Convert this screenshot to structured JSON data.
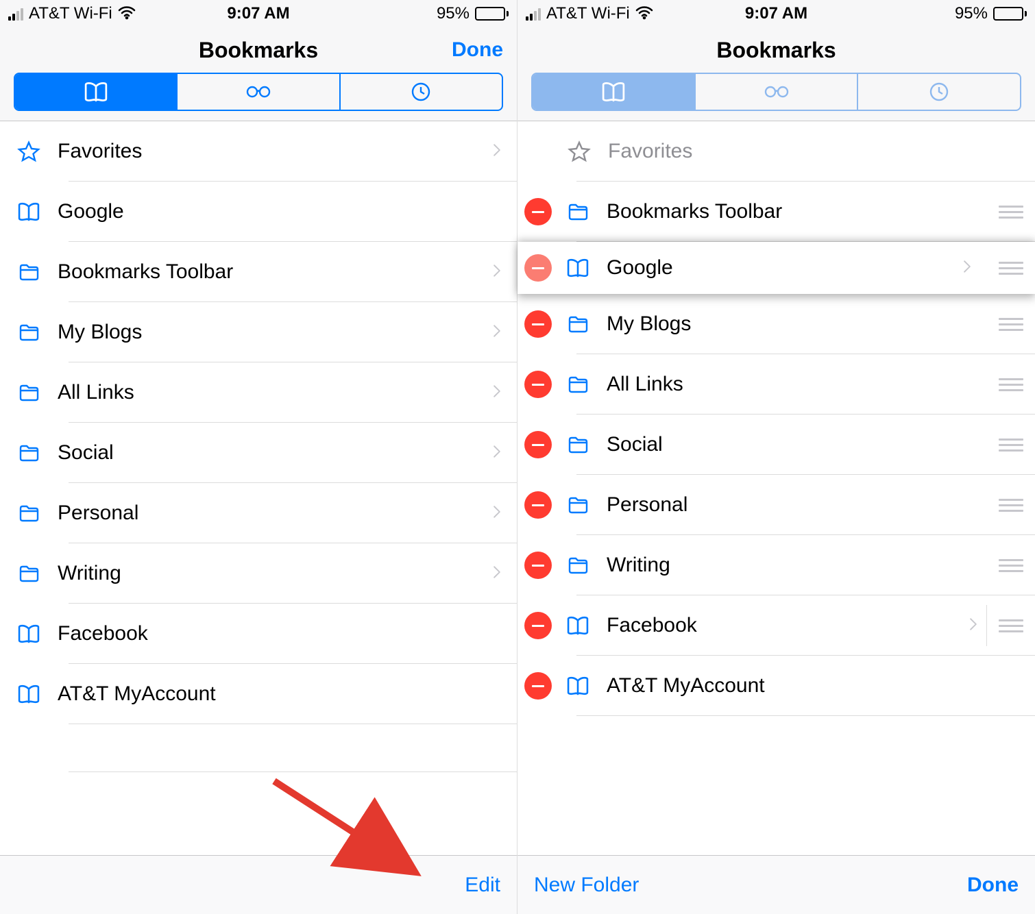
{
  "status": {
    "carrier": "AT&T Wi-Fi",
    "time": "9:07 AM",
    "battery_pct": "95%"
  },
  "left": {
    "title": "Bookmarks",
    "done": "Done",
    "toolbar_edit": "Edit",
    "rows": {
      "favorites": "Favorites",
      "google": "Google",
      "toolbar": "Bookmarks Toolbar",
      "myblogs": "My Blogs",
      "alllinks": "All Links",
      "social": "Social",
      "personal": "Personal",
      "writing": "Writing",
      "facebook": "Facebook",
      "att": "AT&T MyAccount"
    }
  },
  "right": {
    "title": "Bookmarks",
    "toolbar_newfolder": "New Folder",
    "toolbar_done": "Done",
    "rows": {
      "favorites": "Favorites",
      "toolbar": "Bookmarks Toolbar",
      "google": "Google",
      "myblogs": "My Blogs",
      "alllinks": "All Links",
      "social": "Social",
      "personal": "Personal",
      "writing": "Writing",
      "facebook": "Facebook",
      "att": "AT&T MyAccount"
    }
  }
}
